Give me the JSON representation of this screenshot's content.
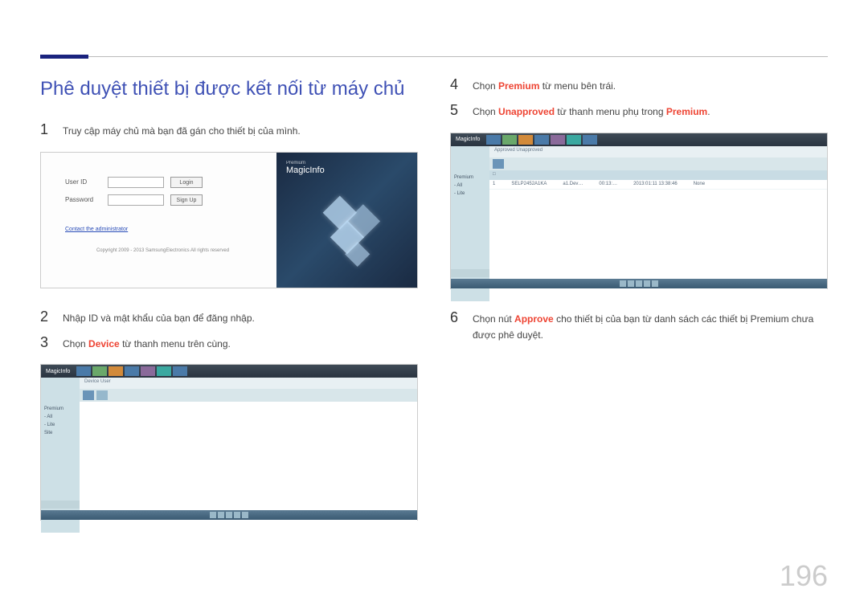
{
  "page_number": "196",
  "title": "Phê duyệt thiết bị được kết nối từ máy chủ",
  "steps": {
    "s1": {
      "num": "1",
      "text": "Truy cập máy chủ mà bạn đã gán cho thiết bị của mình."
    },
    "s2": {
      "num": "2",
      "text": "Nhập ID và mật khẩu của bạn để đăng nhập."
    },
    "s3": {
      "num": "3",
      "pre": "Chọn ",
      "hl": "Device",
      "post": " từ thanh menu trên cùng."
    },
    "s4": {
      "num": "4",
      "pre": "Chọn ",
      "hl": "Premium",
      "post": " từ menu bên trái."
    },
    "s5": {
      "num": "5",
      "pre": "Chọn ",
      "hl": "Unapproved",
      "post1": " từ thanh menu phụ trong ",
      "hl2": "Premium",
      "post2": "."
    },
    "s6": {
      "num": "6",
      "pre": "Chọn nút ",
      "hl": "Approve",
      "post": " cho thiết bị của bạn từ danh sách các thiết bị Premium chưa được phê duyệt."
    }
  },
  "login_shot": {
    "user_label": "User ID",
    "pass_label": "Password",
    "login_btn": "Login",
    "signup_btn": "Sign Up",
    "contact_link": "Contact the administrator",
    "copyright": "Copyright 2009 - 2013 SamsungElectronics All rights reserved",
    "brand_small": "Premium",
    "brand": "MagicInfo"
  },
  "device_shot": {
    "logo": "MagicInfo",
    "side_items": [
      "Premium",
      "- All",
      "- Lite",
      "Site"
    ],
    "tabs": "Device   User"
  },
  "unapp_shot": {
    "logo": "MagicInfo",
    "tabs": "Approved   Unapproved",
    "cells": [
      "1",
      "SELP2452A1KA",
      "a1.Dev…",
      "00:13:…",
      "2013:01:11  13:38:46",
      "None"
    ]
  }
}
